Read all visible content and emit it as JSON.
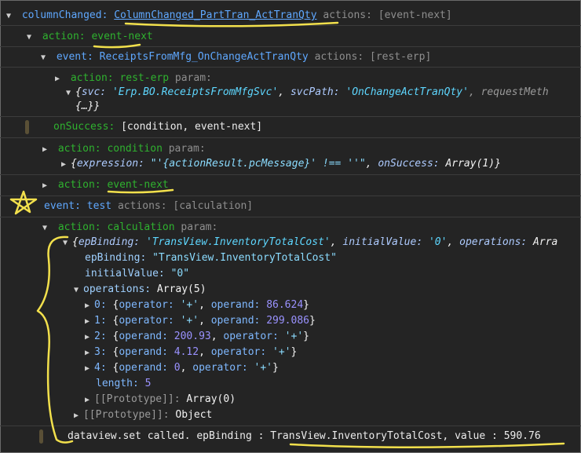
{
  "row1": {
    "label": "columnChanged:",
    "link": "ColumnChanged_PartTran_ActTranQty",
    "actions": "actions: [event-next]"
  },
  "row2": {
    "label": "action:",
    "value": "event-next"
  },
  "row3": {
    "label": "event:",
    "value": "ReceiptsFromMfg_OnChangeActTranQty",
    "actions": "actions: [rest-erp]"
  },
  "row4": {
    "label": "action:",
    "value": "rest-erp",
    "param": "param:"
  },
  "row5": {
    "open": "{",
    "k1": "svc:",
    "v1": "'Erp.BO.ReceiptsFromMfgSvc'",
    "c1": ",",
    "k2": "svcPath:",
    "v2": "'OnChangeActTranQty'",
    "tail": ", requestMeth"
  },
  "row6": {
    "text": "{…}}"
  },
  "row7": {
    "label": "onSuccess:",
    "value": "[condition, event-next]"
  },
  "row8": {
    "label": "action:",
    "value": "condition",
    "param": "param:"
  },
  "row9": {
    "open": "{",
    "k1": "expression:",
    "v1": "\"'{actionResult.pcMessage}' !== ''\"",
    "c1": ",",
    "k2": "onSuccess:",
    "v2": "Array(1)",
    "close": "}"
  },
  "row10": {
    "label": "action:",
    "value": "event-next"
  },
  "row11": {
    "label": "event:",
    "value": "test",
    "actions": "actions: [calculation]"
  },
  "row12": {
    "label": "action:",
    "value": "calculation",
    "param": "param:"
  },
  "row13": {
    "open": "{",
    "k1": "epBinding:",
    "v1": "'TransView.InventoryTotalCost'",
    "c1": ",",
    "k2": "initialValue:",
    "v2": "'0'",
    "c2": ",",
    "k3": "operations:",
    "tail": "Arra"
  },
  "row14": {
    "k": "epBinding:",
    "v": "\"TransView.InventoryTotalCost\""
  },
  "row15": {
    "k": "initialValue:",
    "v": "\"0\""
  },
  "row16": {
    "k": "operations:",
    "v": "Array(5)"
  },
  "ops": [
    {
      "idx": "0:",
      "open": "{",
      "k1": "operator:",
      "v1": "'+'",
      "c": ",",
      "k2": "operand:",
      "v2": "86.624",
      "close": "}"
    },
    {
      "idx": "1:",
      "open": "{",
      "k1": "operator:",
      "v1": "'+'",
      "c": ",",
      "k2": "operand:",
      "v2": "299.086",
      "close": "}"
    },
    {
      "idx": "2:",
      "open": "{",
      "k1": "operand:",
      "v1": "200.93",
      "c": ",",
      "k2": "operator:",
      "v2": "'+'",
      "close": "}"
    },
    {
      "idx": "3:",
      "open": "{",
      "k1": "operand:",
      "v1": "4.12",
      "c": ",",
      "k2": "operator:",
      "v2": "'+'",
      "close": "}"
    },
    {
      "idx": "4:",
      "open": "{",
      "k1": "operand:",
      "v1": "0",
      "c": ",",
      "k2": "operator:",
      "v2": "'+'",
      "close": "}"
    }
  ],
  "length": {
    "k": "length:",
    "v": "5"
  },
  "proto1": {
    "k": "[[Prototype]]:",
    "v": "Array(0)"
  },
  "proto2": {
    "k": "[[Prototype]]:",
    "v": "Object"
  },
  "log": {
    "text": "dataview.set called. epBinding : TransView.InventoryTotalCost, value : 590.76"
  }
}
